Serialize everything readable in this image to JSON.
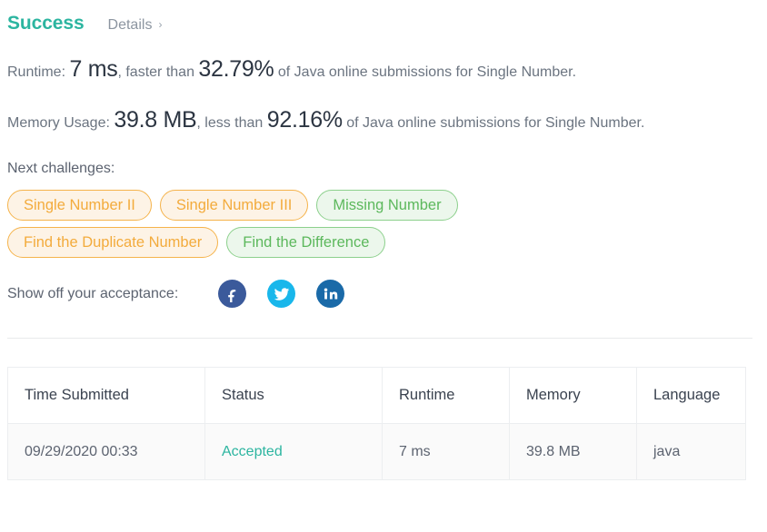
{
  "header": {
    "status": "Success",
    "details_label": "Details",
    "details_chevron": "›"
  },
  "stats": {
    "runtime": {
      "prefix": "Runtime:",
      "value": "7 ms",
      "middle": ", faster than",
      "percent": "32.79%",
      "suffix": "of Java online submissions for Single Number."
    },
    "memory": {
      "prefix": "Memory Usage:",
      "value": "39.8 MB",
      "middle": ", less than",
      "percent": "92.16%",
      "suffix": "of Java online submissions for Single Number."
    }
  },
  "next_challenges": {
    "label": "Next challenges:",
    "rows": [
      [
        {
          "label": "Single Number II",
          "difficulty": "medium"
        },
        {
          "label": "Single Number III",
          "difficulty": "medium"
        },
        {
          "label": "Missing Number",
          "difficulty": "easy"
        }
      ],
      [
        {
          "label": "Find the Duplicate Number",
          "difficulty": "medium"
        },
        {
          "label": "Find the Difference",
          "difficulty": "easy"
        }
      ]
    ],
    "colors": {
      "medium_text": "#f3ab3c",
      "medium_border": "#f5b34b",
      "medium_bg": "#fdf3e6",
      "easy_text": "#5cb85c",
      "easy_border": "#8cd08c",
      "easy_bg": "#ecf7ec"
    }
  },
  "share": {
    "label": "Show off your acceptance:",
    "icons": [
      {
        "name": "facebook-icon",
        "glyph": "f",
        "color": "#3b5a9b"
      },
      {
        "name": "twitter-icon",
        "glyph": "t",
        "color": "#19b7eb"
      },
      {
        "name": "linkedin-icon",
        "glyph": "in",
        "color": "#1a6aa8"
      }
    ]
  },
  "submissions_table": {
    "columns": [
      "Time Submitted",
      "Status",
      "Runtime",
      "Memory",
      "Language"
    ],
    "rows": [
      {
        "time_submitted": "09/29/2020 00:33",
        "status": "Accepted",
        "runtime": "7 ms",
        "memory": "39.8 MB",
        "language": "java"
      }
    ],
    "status_color": "#2cb5a0"
  }
}
